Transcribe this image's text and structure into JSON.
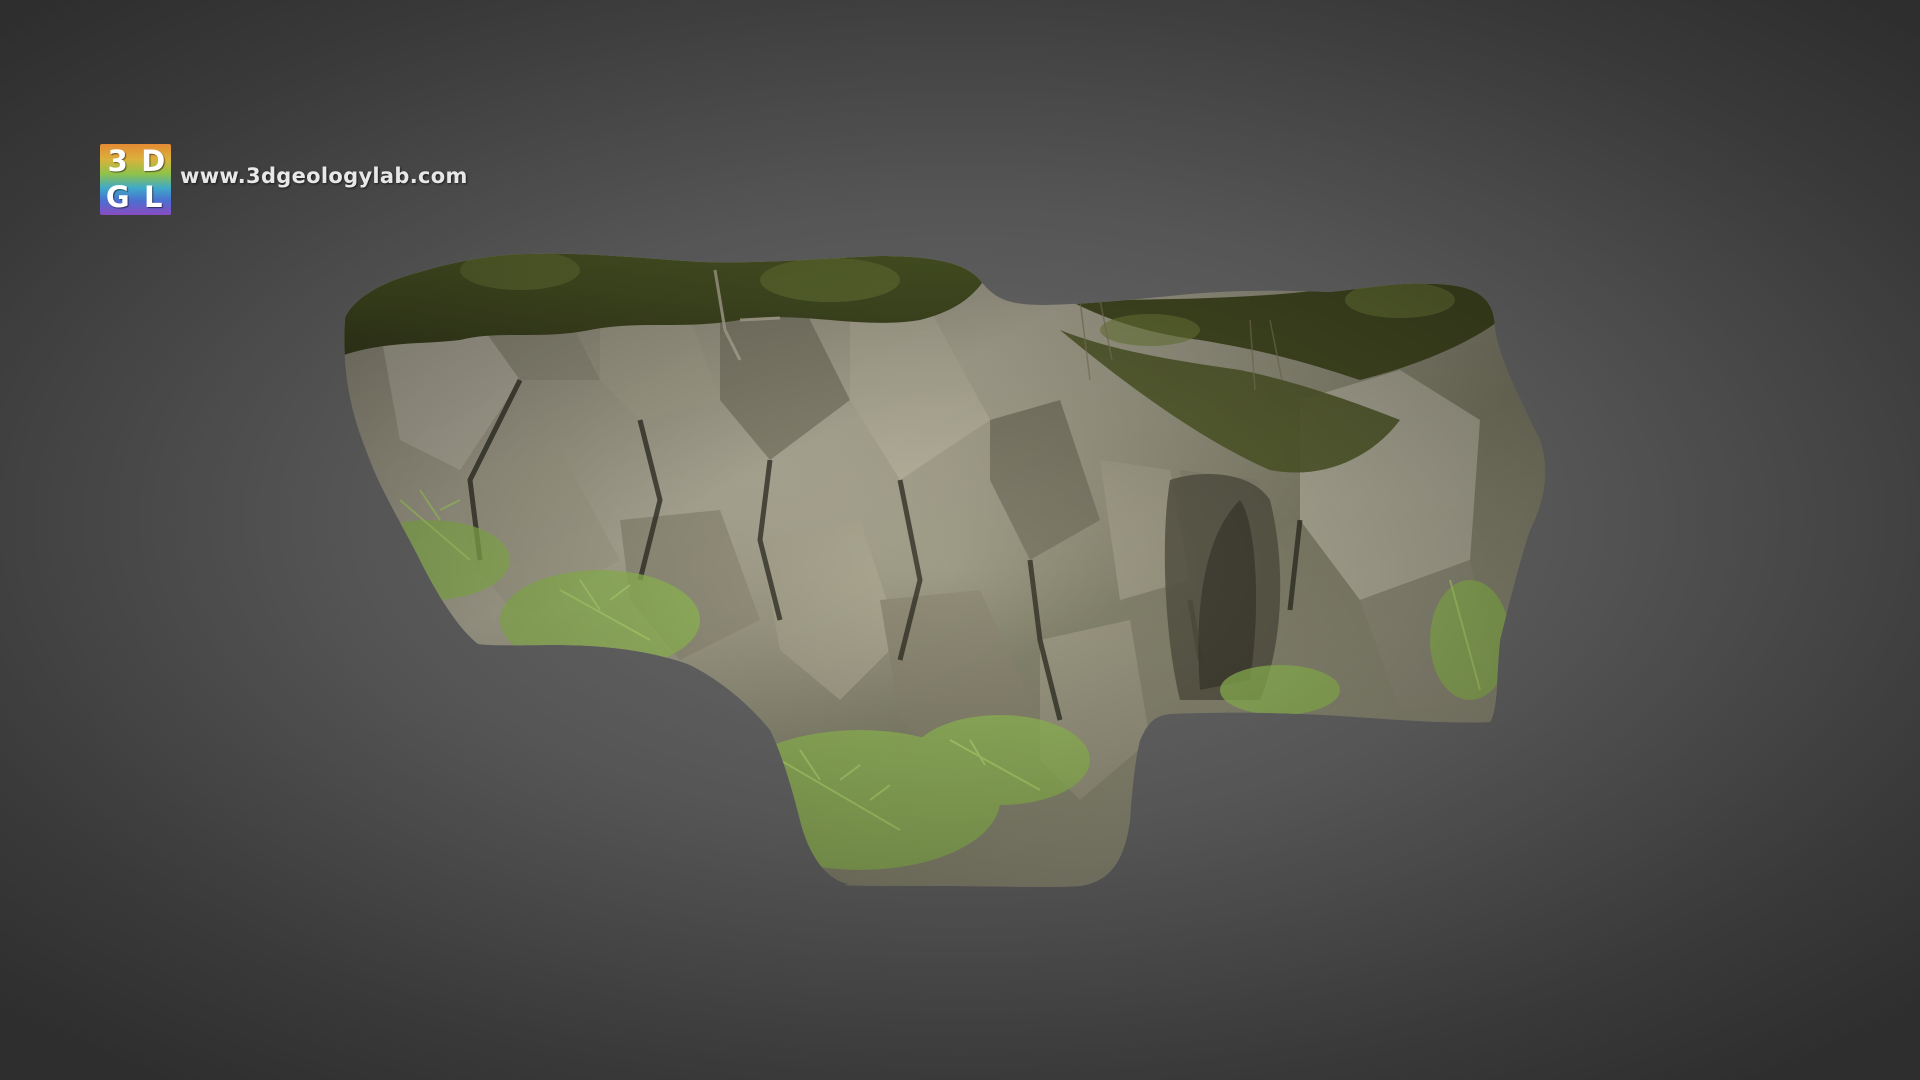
{
  "viewer": {
    "logo": {
      "tl": "3",
      "tr": "D",
      "bl": "G",
      "br": "L"
    },
    "website": "www.3dgeologylab.com",
    "model": {
      "subject": "rock-outcrop-3d-model",
      "colors": {
        "rock_light": "#b8b4a0",
        "rock_mid": "#8e8a78",
        "rock_dark": "#4e4a3a",
        "moss": "#6b7a3a",
        "fern": "#9cc85a",
        "shadow": "#2a2a20"
      }
    }
  }
}
